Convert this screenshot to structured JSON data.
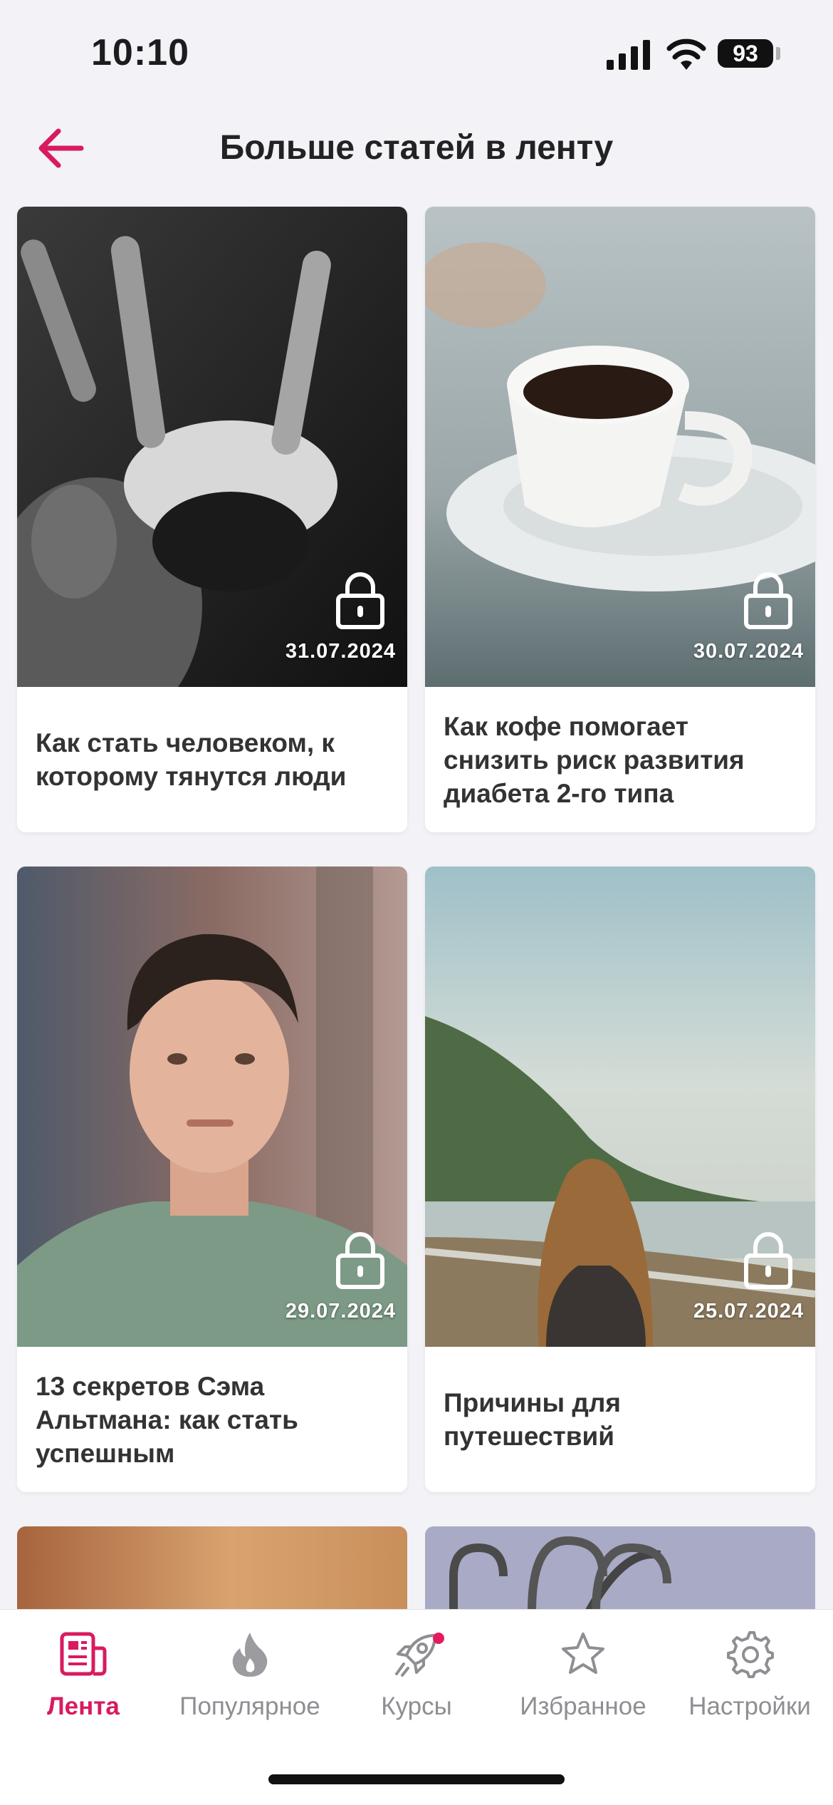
{
  "status_bar": {
    "time": "10:10",
    "battery": "93",
    "icons": [
      "signal-icon",
      "wifi-icon",
      "battery-icon"
    ]
  },
  "header": {
    "title": "Больше статей в ленту",
    "back_icon": "arrow-left-icon"
  },
  "articles": [
    {
      "date": "31.07.2024",
      "title": "Как стать человеком, к которому тянутся люди",
      "locked": true
    },
    {
      "date": "30.07.2024",
      "title": "Как кофе помогает снизить риск развития диабета 2-го типа",
      "locked": true
    },
    {
      "date": "29.07.2024",
      "title": "13 секретов Сэма Альтмана: как стать успешным",
      "locked": true
    },
    {
      "date": "25.07.2024",
      "title": "Причины для путешествий",
      "locked": true
    }
  ],
  "tabs": [
    {
      "label": "Лента",
      "icon": "feed-icon",
      "active": true
    },
    {
      "label": "Популярное",
      "icon": "flame-icon"
    },
    {
      "label": "Курсы",
      "icon": "rocket-icon",
      "badge": true
    },
    {
      "label": "Избранное",
      "icon": "star-icon"
    },
    {
      "label": "Настройки",
      "icon": "gear-icon"
    }
  ],
  "colors": {
    "accent": "#d81b60",
    "inactive": "#8e8e93",
    "background": "#f2f2f7"
  }
}
